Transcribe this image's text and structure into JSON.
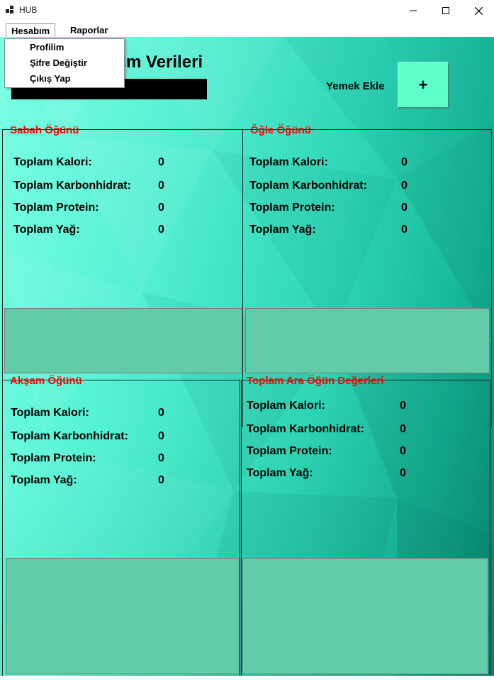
{
  "window": {
    "title": "HUB"
  },
  "menu": {
    "hesabim": "Hesabım",
    "raporlar": "Raporlar"
  },
  "dropdown": [
    "Profilim",
    "Şifre Değiştir",
    "Çıkış Yap"
  ],
  "header": {
    "title": "Beslenme Takip / Tüketim Verileri",
    "title_visible": "etim Verileri",
    "yemek_ekle": "Yemek Ekle",
    "add_symbol": "+"
  },
  "meals": {
    "sabah": {
      "title": "Sabah Öğünü",
      "labels": [
        "Toplam Kalori:",
        "Toplam Karbonhidrat:",
        "Toplam Protein:",
        "Toplam Yağ:"
      ],
      "values": [
        "0",
        "0",
        "0",
        "0"
      ]
    },
    "ogle": {
      "title": "Öğle Öğünü",
      "labels": [
        "Toplam Kalori:",
        "Toplam Karbonhidrat:",
        "Toplam Protein:",
        "Toplam Yağ:"
      ],
      "values": [
        "0",
        "0",
        "0",
        "0"
      ]
    },
    "aksam": {
      "title": "Akşam Öğünü",
      "labels": [
        "Toplam Kalori:",
        "Toplam Karbonhidrat:",
        "Toplam Protein:",
        "Toplam Yağ:"
      ],
      "values": [
        "0",
        "0",
        "0",
        "0"
      ]
    },
    "ara": {
      "title": "Toplam Ara Öğün Değerleri",
      "labels": [
        "Toplam Kalori:",
        "Toplam Karbonhidrat:",
        "Toplam Protein:",
        "Toplam Yağ:"
      ],
      "values": [
        "0",
        "0",
        "0",
        "0"
      ]
    }
  },
  "colors": {
    "accent_red": "#ff0000",
    "panel": "#62cca8",
    "button": "#5effc9"
  }
}
